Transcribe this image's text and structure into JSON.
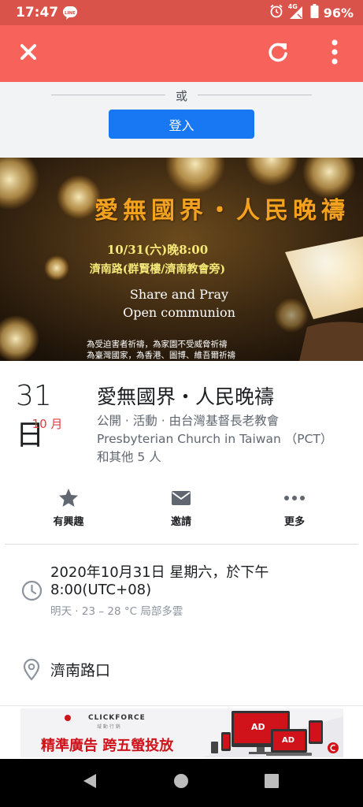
{
  "status_bar": {
    "time": "17:47",
    "battery": "96%",
    "network": "4G",
    "icons": [
      "line-icon",
      "alarm-icon",
      "signal-icon",
      "battery-icon"
    ]
  },
  "toolbar": {
    "icons": [
      "close-icon",
      "refresh-icon",
      "more-vert-icon"
    ],
    "background": "#f7625a"
  },
  "login": {
    "or_text": "或",
    "button_label": "登入",
    "button_color": "#1877f2"
  },
  "cover": {
    "title": "愛無國界・人民晚禱",
    "datetime": "10/31(六)晚8:00",
    "venue": "濟南路(群賢樓/濟南教會旁)",
    "english_line1": "Share and Pray",
    "english_line2": "Open communion",
    "prayer_line1": "為受迫害者祈禱，為家園不受威脅祈禱",
    "prayer_line2": "為臺灣國家，為香港、圖博、維吾爾祈禱"
  },
  "event": {
    "day": "31日",
    "month": "10 月",
    "title": "愛無國界・人民晚禱",
    "meta_line1": "公開 · 活動 · 由台灣基督長老教會",
    "meta_line2": "Presbyterian Church in Taiwan （PCT）",
    "meta_line3": "和其他 5 人",
    "month_color": "#e0393e"
  },
  "actions": [
    {
      "label": "有興趣",
      "icon": "star-icon"
    },
    {
      "label": "邀請",
      "icon": "envelope-icon"
    },
    {
      "label": "更多",
      "icon": "more-horiz-icon"
    }
  ],
  "details": {
    "time_line1": "2020年10月31日 星期六，於下午",
    "time_line2": "8:00(UTC+08)",
    "weather": "明天 · 23 – 28 °C 局部多雲",
    "location": "濟南路口"
  },
  "ad": {
    "brand": "CLICKFORCE",
    "brand_sub": "域 動 行 銷",
    "text": "精準廣告 跨五螢投放",
    "screen_label": "AD"
  },
  "nav_bar": {
    "icons": [
      "back-icon",
      "home-icon",
      "recents-icon"
    ]
  }
}
